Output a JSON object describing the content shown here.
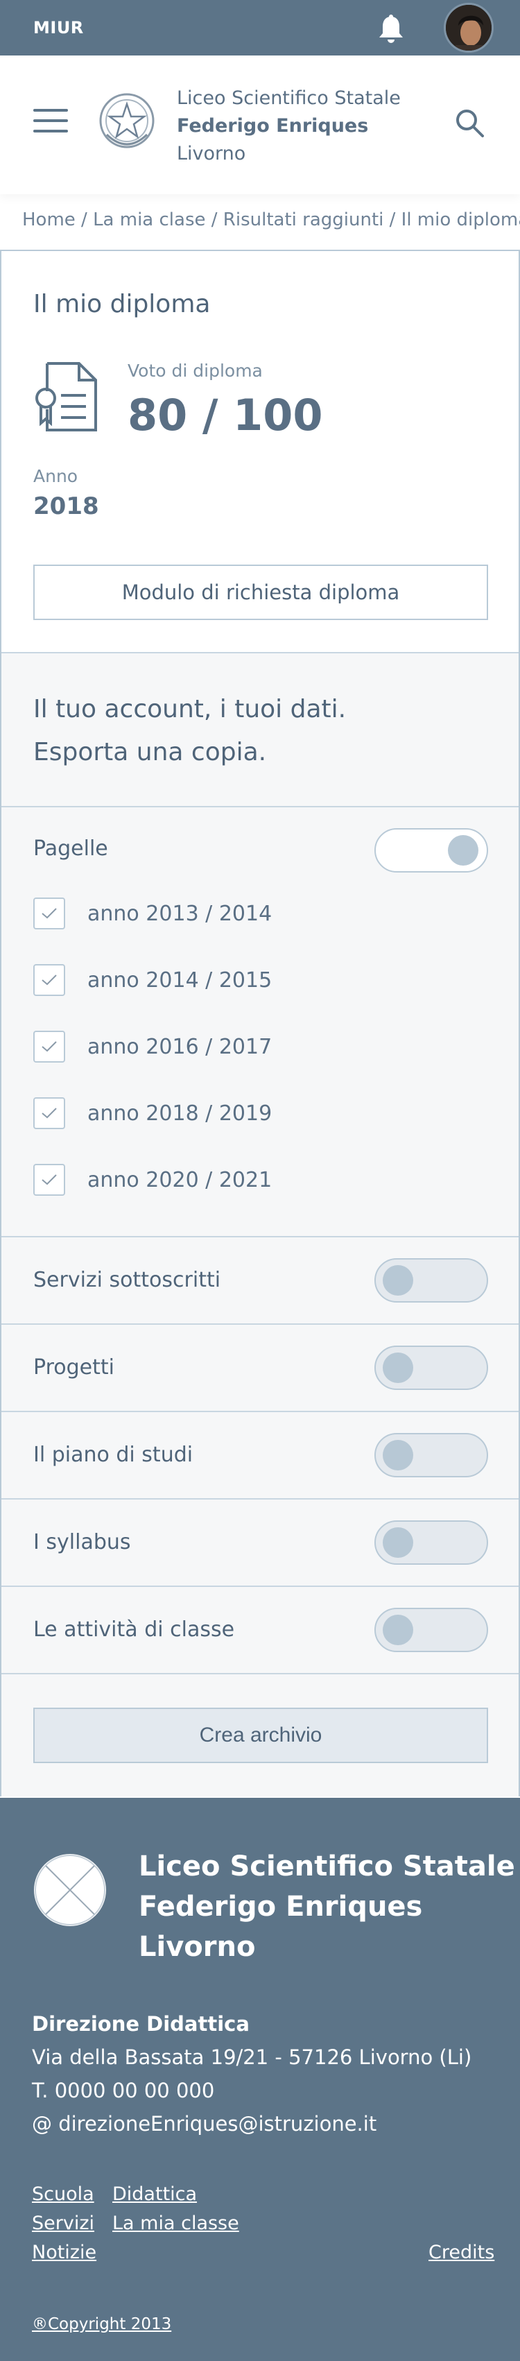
{
  "topbar": {
    "org": "MIUR"
  },
  "header": {
    "school_line1": "Liceo Scientifico Statale",
    "school_line2": "Federigo Enriques",
    "school_line3": "Livorno"
  },
  "breadcrumb": "Home / La mia clase / Risultati raggiunti / Il mio diploma",
  "diploma": {
    "title": "Il mio diploma",
    "vote_label": "Voto di diploma",
    "vote_value": "80 / 100",
    "year_label": "Anno",
    "year_value": "2018",
    "request_button": "Modulo di richiesta diploma"
  },
  "account": {
    "line1": "Il tuo account, i tuoi dati.",
    "line2": "Esporta una copia."
  },
  "pagelle": {
    "label": "Pagelle",
    "toggle_on": true,
    "years": [
      "anno 2013 / 2014",
      "anno 2014 / 2015",
      "anno 2016 / 2017",
      "anno 2018 / 2019",
      "anno 2020 / 2021"
    ]
  },
  "sections": [
    {
      "label": "Servizi sottoscritti",
      "toggle_on": false
    },
    {
      "label": "Progetti",
      "toggle_on": false
    },
    {
      "label": "Il piano di studi",
      "toggle_on": false
    },
    {
      "label": "I syllabus",
      "toggle_on": false
    },
    {
      "label": "Le attività di classe",
      "toggle_on": false
    }
  ],
  "archive_button": "Crea archivio",
  "footer": {
    "title1": "Liceo Scientifico Statale",
    "title2": "Federigo Enriques",
    "title3": "Livorno",
    "dir_title": "Direzione Didattica",
    "address": "Via della Bassata 19/21 - 57126 Livorno (Li)",
    "phone": "T. 0000 00 00 000",
    "email": "@ direzioneEnriques@istruzione.it",
    "links": {
      "scuola": "Scuola",
      "didattica": "Didattica",
      "servizi": "Servizi",
      "la_mia_classe": "La mia classe",
      "notizie": "Notizie",
      "credits": "Credits"
    },
    "copyright": "®Copyright 2013"
  },
  "colors": {
    "primary": "#5c7488",
    "text": "#5a6f84",
    "border": "#b9cad7",
    "section_bg": "#f6f7f8"
  }
}
